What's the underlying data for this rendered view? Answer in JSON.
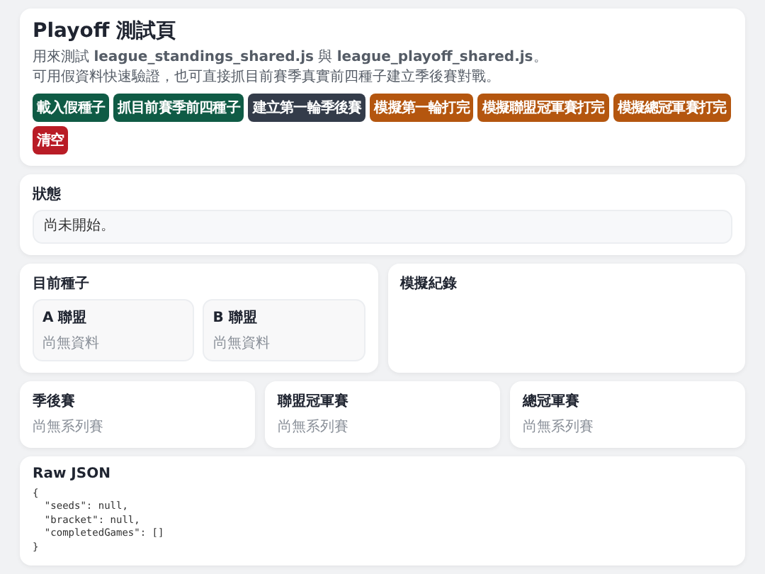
{
  "header": {
    "title": "Playoff 測試頁",
    "description": "用來測試 **league_standings_shared.js** 與 **league_playoff_shared.js**。",
    "note": "可用假資料快速驗證，也可直接抓目前賽季真實前四種子建立季後賽對戰。",
    "buttons": [
      {
        "label": "載入假種子",
        "color": "#0f5b45"
      },
      {
        "label": "抓目前賽季前四種子",
        "color": "#0f5b45"
      },
      {
        "label": "建立第一輪季後賽",
        "color": "#343c4a"
      },
      {
        "label": "模擬第一輪打完",
        "color": "#b4560f"
      },
      {
        "label": "模擬聯盟冠軍賽打完",
        "color": "#b4560f"
      },
      {
        "label": "模擬總冠軍賽打完",
        "color": "#b4560f"
      },
      {
        "label": "清空",
        "color": "#b91c26"
      }
    ]
  },
  "status": {
    "title": "狀態",
    "message": "尚未開始。"
  },
  "seeds": {
    "title": "目前種子",
    "leagues": [
      {
        "name": "A 聯盟",
        "empty": "尚無資料"
      },
      {
        "name": "B 聯盟",
        "empty": "尚無資料"
      }
    ]
  },
  "log": {
    "title": "模擬紀錄"
  },
  "series": [
    {
      "title": "季後賽",
      "empty": "尚無系列賽"
    },
    {
      "title": "聯盟冠軍賽",
      "empty": "尚無系列賽"
    },
    {
      "title": "總冠軍賽",
      "empty": "尚無系列賽"
    }
  ],
  "raw": {
    "title": "Raw JSON",
    "code": "{\n  \"seeds\": null,\n  \"bracket\": null,\n  \"completedGames\": []\n}"
  }
}
